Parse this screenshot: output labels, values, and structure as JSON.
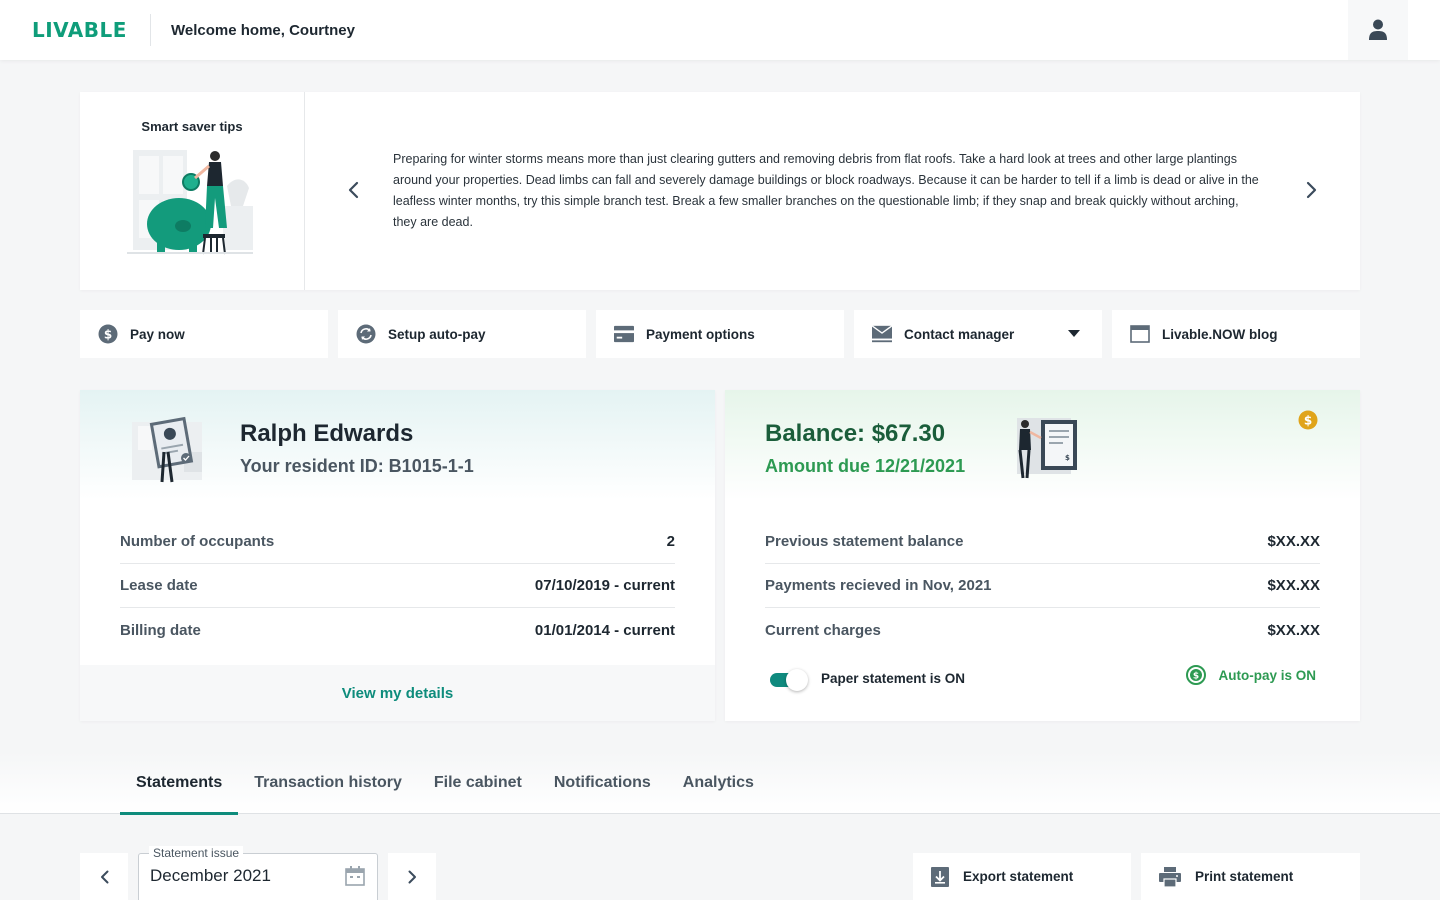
{
  "header": {
    "logo": "LIVABLE",
    "welcome": "Welcome home, Courtney"
  },
  "tips": {
    "title": "Smart saver tips",
    "text": "Preparing for winter storms means more than just clearing gutters and removing debris from flat roofs. Take a hard look at trees and other large plantings around your properties. Dead limbs can fall and severely damage buildings or block roadways. Because it can be harder to tell if a limb is dead or alive in the leafless winter months, try this simple branch test. Break a few smaller branches on the questionable limb; if they snap and break quickly without arching, they are dead."
  },
  "actions": [
    {
      "label": "Pay now",
      "icon": "dollar-circle-icon"
    },
    {
      "label": "Setup auto-pay",
      "icon": "autopay-cycle-icon"
    },
    {
      "label": "Payment options",
      "icon": "credit-card-icon"
    },
    {
      "label": "Contact manager",
      "icon": "envelope-icon"
    },
    {
      "label": "Livable.NOW blog",
      "icon": "browser-window-icon"
    }
  ],
  "resident": {
    "name": "Ralph Edwards",
    "resident_id": "Your resident ID: B1015-1-1",
    "rows": [
      {
        "label": "Number of occupants",
        "value": "2"
      },
      {
        "label": "Lease date",
        "value": "07/10/2019 - current"
      },
      {
        "label": "Billing date",
        "value": "01/01/2014 - current"
      }
    ],
    "view_details": "View my details"
  },
  "balance": {
    "title": "Balance: $67.30",
    "due": "Amount due 12/21/2021",
    "rows": [
      {
        "label": "Previous statement balance",
        "value": "$XX.XX"
      },
      {
        "label": "Payments recieved in Nov, 2021",
        "value": "$XX.XX"
      },
      {
        "label": "Current charges",
        "value": "$XX.XX"
      }
    ],
    "paper_statement": "Paper statement is ON",
    "paper_toggle_on": true,
    "autopay": "Auto-pay is ON"
  },
  "tabs": [
    {
      "label": "Statements",
      "active": true
    },
    {
      "label": "Transaction history",
      "active": false
    },
    {
      "label": "File cabinet",
      "active": false
    },
    {
      "label": "Notifications",
      "active": false
    },
    {
      "label": "Analytics",
      "active": false
    }
  ],
  "statement": {
    "field_label": "Statement issue",
    "value": "December 2021",
    "export_label": "Export statement",
    "print_label": "Print statement"
  },
  "colors": {
    "brand": "#0f9d7a",
    "accent_teal": "#0e8c7c",
    "balance_green": "#1a5d3a",
    "positive_green": "#2d9a52",
    "coin_gold": "#e0a41a",
    "icon_slate": "#5d6b78"
  }
}
